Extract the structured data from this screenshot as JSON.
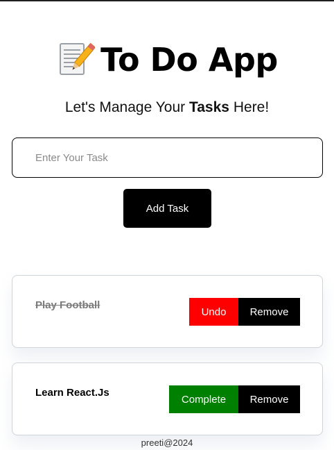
{
  "header": {
    "title": "To Do App",
    "title_icon": "memo-pencil-icon",
    "subtitle_prefix": "Let's Manage Your ",
    "subtitle_bold": "Tasks",
    "subtitle_suffix": " Here!"
  },
  "input": {
    "placeholder": "Enter Your Task",
    "value": ""
  },
  "add_button": {
    "label": "Add Task"
  },
  "tasks": [
    {
      "name": "Play Football",
      "completed": true,
      "toggle_label": "Undo",
      "remove_label": "Remove"
    },
    {
      "name": "Learn React.Js",
      "completed": false,
      "toggle_label": "Complete",
      "remove_label": "Remove"
    }
  ],
  "footer": {
    "text": "preeti@2024"
  },
  "colors": {
    "undo": "#ff0000",
    "complete": "#008000",
    "remove": "#000000",
    "primary": "#000000"
  }
}
